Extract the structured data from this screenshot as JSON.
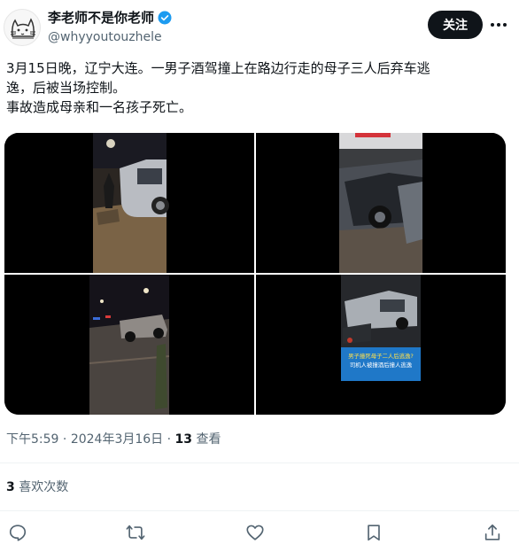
{
  "author": {
    "display_name": "李老师不是你老师",
    "handle": "@whyyoutouzhele",
    "verified_icon": "verified-badge-icon",
    "avatar_icon": "cat-sketch-avatar"
  },
  "header": {
    "follow_label": "关注",
    "more_icon": "more-dots-icon"
  },
  "tweet": {
    "lines": [
      "3月15日晚，辽宁大连。一男子酒驾撞上在路边行走的母子三人后弃车逃",
      "逸，后被当场控制。",
      "事故造成母亲和一名孩子死亡。"
    ]
  },
  "media": {
    "count": 4,
    "thumbnails": [
      {
        "caption": "",
        "icon": "night-crash-photo"
      },
      {
        "caption": "",
        "icon": "wrecked-car-photo"
      },
      {
        "caption": "",
        "icon": "street-scene-photo"
      },
      {
        "caption_line1": "男子撞死母子二人后逃逸?",
        "caption_line2": "司机人被撞酒后撞人逃逸"
      }
    ]
  },
  "meta": {
    "time": "下午5:59",
    "sep": "·",
    "date": "2024年3月16日",
    "views_count": "13",
    "views_label": "查看"
  },
  "engagement": {
    "likes_count": "3",
    "likes_label": "喜欢次数"
  },
  "actions": [
    {
      "icon": "reply-icon"
    },
    {
      "icon": "retweet-icon"
    },
    {
      "icon": "like-heart-icon"
    },
    {
      "icon": "bookmark-icon"
    },
    {
      "icon": "share-icon"
    }
  ],
  "colors": {
    "text": "#0f1419",
    "secondary": "#536471",
    "verified": "#1d9bf0",
    "divider": "#eff3f4",
    "follow_bg": "#0f1419"
  }
}
